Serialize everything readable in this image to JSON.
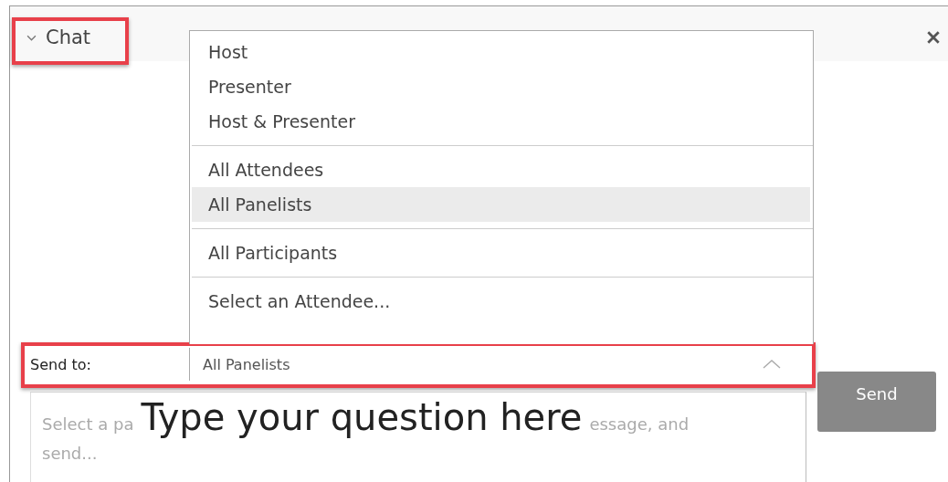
{
  "header": {
    "title": "Chat",
    "expanded": true
  },
  "send_to_menu": {
    "groups": [
      [
        {
          "label": "Host",
          "selected": false
        },
        {
          "label": "Presenter",
          "selected": false
        },
        {
          "label": "Host & Presenter",
          "selected": false
        }
      ],
      [
        {
          "label": "All Attendees",
          "selected": false
        },
        {
          "label": "All Panelists",
          "selected": true
        }
      ],
      [
        {
          "label": "All Participants",
          "selected": false
        }
      ],
      [
        {
          "label": "Select an Attendee...",
          "selected": false
        }
      ]
    ]
  },
  "send_to": {
    "label": "Send to:",
    "value": "All Panelists",
    "open": true
  },
  "message_field": {
    "placeholder_start": "Select a pa",
    "placeholder_end": "essage, and",
    "placeholder_line_2": "send..."
  },
  "annotation": {
    "text": "Type your question here"
  },
  "send_button": "Send"
}
